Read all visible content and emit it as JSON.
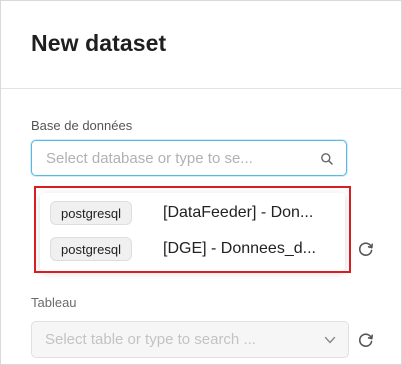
{
  "dialog": {
    "title": "New dataset"
  },
  "database": {
    "label": "Base de données",
    "placeholder": "Select database or type to se...",
    "options": [
      {
        "tag": "postgresql",
        "name": "[DataFeeder] - Don..."
      },
      {
        "tag": "postgresql",
        "name": "[DGE] - Donnees_d..."
      }
    ]
  },
  "table": {
    "label": "Tableau",
    "placeholder": "Select table or type to search ..."
  },
  "icons": {
    "search": "search-icon",
    "refresh": "refresh-icon",
    "chevron": "chevron-down-icon"
  },
  "colors": {
    "focus_border": "#57b8e4",
    "highlight_box": "#d81e25"
  }
}
